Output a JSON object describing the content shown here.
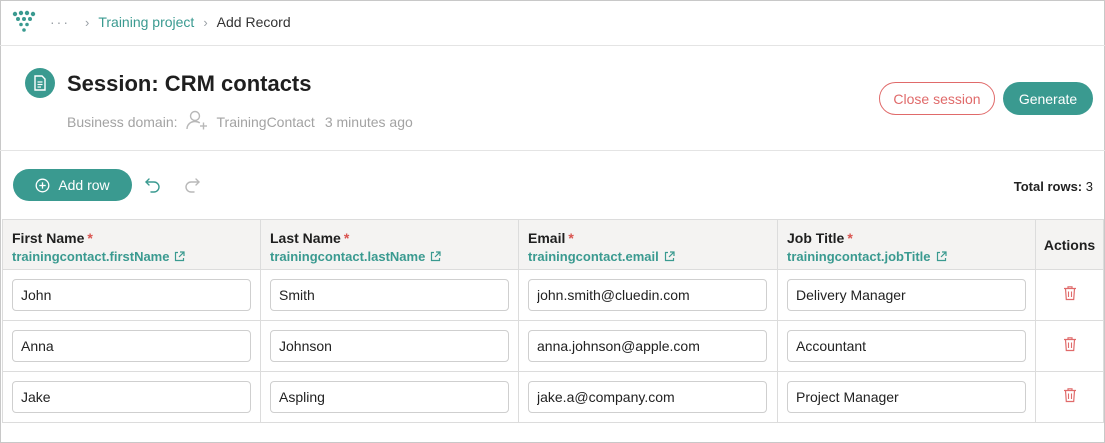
{
  "breadcrumb": {
    "more": "···",
    "project": "Training project",
    "current": "Add Record"
  },
  "header": {
    "title": "Session: CRM contacts",
    "business_domain_label": "Business domain:",
    "business_domain_value": "TrainingContact",
    "updated": "3 minutes ago",
    "close_session_label": "Close session",
    "generate_label": "Generate"
  },
  "toolbar": {
    "add_row_label": "Add row",
    "total_rows_label": "Total rows:",
    "total_rows_value": "3"
  },
  "table": {
    "columns": [
      {
        "label": "First Name",
        "required": "*",
        "field": "trainingcontact.firstName"
      },
      {
        "label": "Last Name",
        "required": "*",
        "field": "trainingcontact.lastName"
      },
      {
        "label": "Email",
        "required": "*",
        "field": "trainingcontact.email"
      },
      {
        "label": "Job Title",
        "required": "*",
        "field": "trainingcontact.jobTitle"
      }
    ],
    "actions_label": "Actions",
    "rows": [
      {
        "first": "John",
        "last": "Smith",
        "email": "john.smith@cluedin.com",
        "job": "Delivery Manager"
      },
      {
        "first": "Anna",
        "last": "Johnson",
        "email": "anna.johnson@apple.com",
        "job": "Accountant"
      },
      {
        "first": "Jake",
        "last": "Aspling",
        "email": "jake.a@company.com",
        "job": "Project Manager"
      }
    ]
  },
  "colors": {
    "accent": "#3a9a90",
    "danger": "#e06a6a",
    "required": "#d9534f",
    "header_bg": "#f4f3f2"
  },
  "icons": {
    "logo": "cluedin-logo-icon",
    "doc": "document-icon",
    "user": "user-add-icon",
    "undo": "undo-icon",
    "redo": "redo-icon",
    "external": "external-link-icon",
    "trash": "trash-icon"
  }
}
